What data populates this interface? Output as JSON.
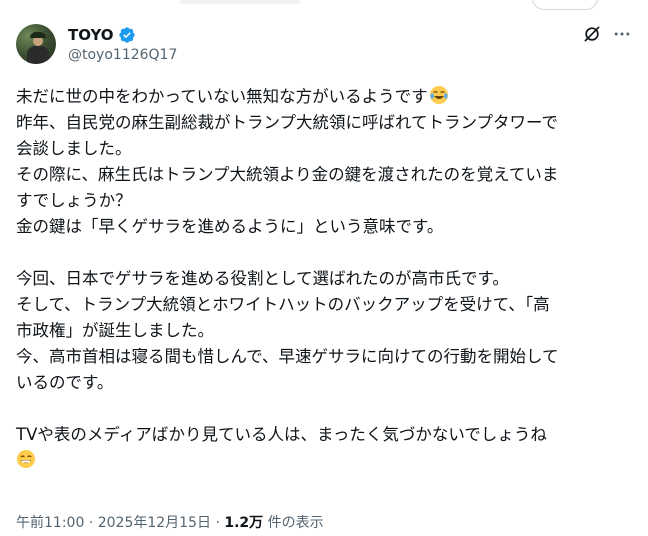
{
  "author": {
    "display_name": "TOYO",
    "handle": "@toyo1126Q17",
    "verified": true
  },
  "icons": {
    "verified": "verified-badge-icon",
    "grok": "grok-icon",
    "more": "more-icon",
    "emoji_tears": "face-with-tears-of-joy",
    "emoji_grin": "grinning-face-with-smiling-eyes"
  },
  "colors": {
    "verified_blue": "#1d9bf0",
    "secondary_text": "#536471",
    "primary_text": "#0f1419"
  },
  "tweet": {
    "lines": [
      "未だに世の中をわかっていない無知な方がいるようです",
      "昨年、自民党の麻生副総裁がトランプ大統領に呼ばれてトランプタワーで",
      "会談しました。",
      "その際に、麻生氏はトランプ大統領より金の鍵を渡されたのを覚えていま",
      "すでしょうか？",
      "金の鍵は「早くゲサラを進めるように」という意味です。",
      "",
      "今回、日本でゲサラを進める役割として選ばれたのが高市氏です。",
      "そして、トランプ大統領とホワイトハットのバックアップを受けて、「高",
      "市政権」が誕生しました。",
      "今、高市首相は寝る間も惜しんで、早速ゲサラに向けての行動を開始して",
      "いるのです。",
      "",
      "TVや表のメディアばかり見ている人は、まったく気づかないでしょうね",
      ""
    ]
  },
  "meta": {
    "time": "午前11:00",
    "separator": "·",
    "date": "2025年12月15日",
    "views_count": "1.2万",
    "views_label": "件の表示"
  }
}
